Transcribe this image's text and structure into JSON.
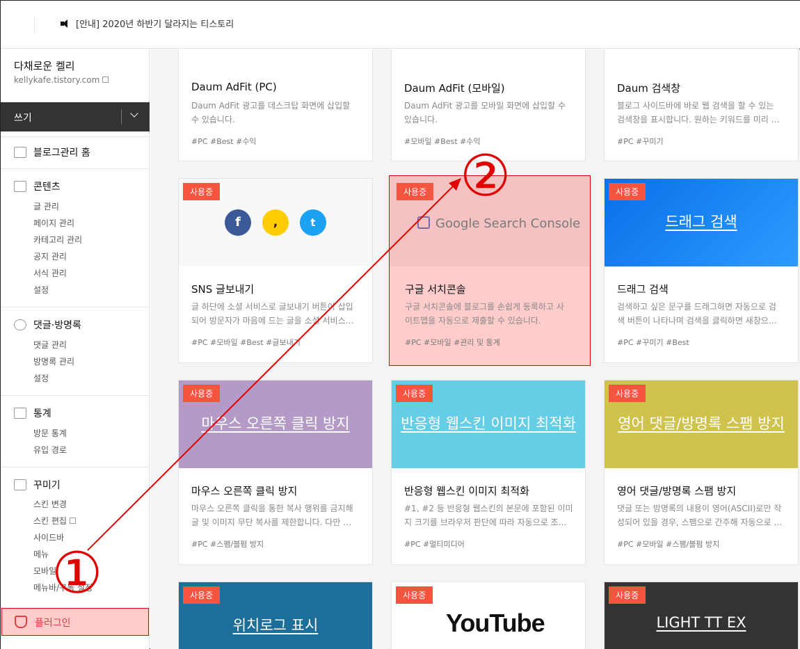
{
  "topbar": {
    "notice": "[안내] 2020년 하반기 달라지는 티스토리"
  },
  "sidebar": {
    "blog_name": "다채로운 켈리",
    "blog_url": "kellykafe.tistory.com",
    "write_label": "쓰기",
    "sections": [
      {
        "title": "블로그관리 홈",
        "icon": "home-icon",
        "items": []
      },
      {
        "title": "콘텐츠",
        "icon": "document-icon",
        "items": [
          "글 관리",
          "페이지 관리",
          "카테고리 관리",
          "공지 관리",
          "서식 관리",
          "설정"
        ]
      },
      {
        "title": "댓글·방명록",
        "icon": "comment-icon",
        "items": [
          "댓글 관리",
          "방명록 관리",
          "설정"
        ]
      },
      {
        "title": "통계",
        "icon": "chart-icon",
        "items": [
          "방문 통계",
          "유입 경로"
        ]
      },
      {
        "title": "꾸미기",
        "icon": "layout-icon",
        "items": [
          "스킨 변경",
          "스킨 편집",
          "사이드바",
          "메뉴",
          "모바일",
          "메뉴바/구독 설정"
        ]
      }
    ],
    "plugin_label": "플러그인"
  },
  "cards": [
    {
      "name": "Daum AdFit (PC)",
      "desc": [
        "Daum AdFit 광고를 데스크탑 화면에 삽입할",
        "수 있습니다."
      ],
      "tags": "#PC   #Best   #수익"
    },
    {
      "name": "Daum AdFit (모바일)",
      "desc": [
        "Daum AdFit 광고를 모바일 화면에 삽입할 수",
        "있습니다."
      ],
      "tags": "#모바일   #Best   #수익"
    },
    {
      "name": "Daum 검색창",
      "desc": [
        "블로그 사이드바에 바로 웹 검색을 할 수 있는",
        "검색창을 표시합니다. 원하는 키워드를 미리 …"
      ],
      "tags": "#PC   #꾸미기"
    },
    {
      "badge": "사용중",
      "name": "SNS 글보내기",
      "desc": [
        "글 하단에 소셜 서비스로 글보내기 버튼이 삽입",
        "되어 방문자가 마음에 드는 글을 소셜 서비스…"
      ],
      "tags": "#PC   #모바일   #Best   #글보내기"
    },
    {
      "badge": "사용중",
      "thumb_text": "Google Search Console",
      "name": "구글 서치콘솔",
      "desc": [
        "구글 서치콘솔에 블로그를 손쉽게 등록하고 사",
        "이트맵을 자동으로 제출할 수 있습니다."
      ],
      "tags": "#PC   #모바일   #관리 및 통계"
    },
    {
      "badge": "사용중",
      "thumb_text": "드래그 검색",
      "name": "드래그 검색",
      "desc": [
        "검색하고 싶은 문구를 드래그하면 자동으로 검",
        "색 버튼이 나타나며 검색을 클릭하면 새창으…"
      ],
      "tags": "#PC   #꾸미기   #Best"
    },
    {
      "badge": "사용중",
      "thumb_text": "마우스 오른쪽 클릭 방지",
      "name": "마우스 오른쪽 클릭 방지",
      "desc": [
        "마우스 오른쪽 클릭을 통한 복사 행위를 금지해",
        "글 및 이미지 무단 복사를 제한합니다. 다만 …"
      ],
      "tags": "#PC   #스팸/블펌 방지"
    },
    {
      "badge": "사용중",
      "thumb_text": "반응형 웹스킨 이미지 최적화",
      "name": "반응형 웹스킨 이미지 최적화",
      "desc": [
        "#1, #2 등 반응형 웹스킨의 본문에 포함된 이미",
        "지 크기를 브라우저 판단에 따라 자동으로 조…"
      ],
      "tags": "#PC   #멀티미디어"
    },
    {
      "badge": "사용중",
      "thumb_text": "영어 댓글/방명록 스팸 방지",
      "name": "영어 댓글/방명록 스팸 방지",
      "desc": [
        "댓글 또는 방명록의 내용이 영어(ASCII)로만 작",
        "성되어 있을 경우, 스팸으로 간주해 자동으로 …"
      ],
      "tags": "#PC   #모바일   #스팸/블펌 방지"
    },
    {
      "badge": "사용중",
      "thumb_text": "위치로그 표시"
    },
    {
      "badge": "사용중",
      "thumb_text": "YouTube"
    },
    {
      "badge": "사용중",
      "thumb_text": "LIGHT TT EX"
    }
  ],
  "annotations": {
    "step1": "①",
    "step2": "②"
  },
  "colors": {
    "badge": "#f5543f",
    "highlight": "#e00000",
    "facebook": "#3b5998",
    "kakao": "#ffcd00",
    "twitter": "#1da1f2"
  }
}
